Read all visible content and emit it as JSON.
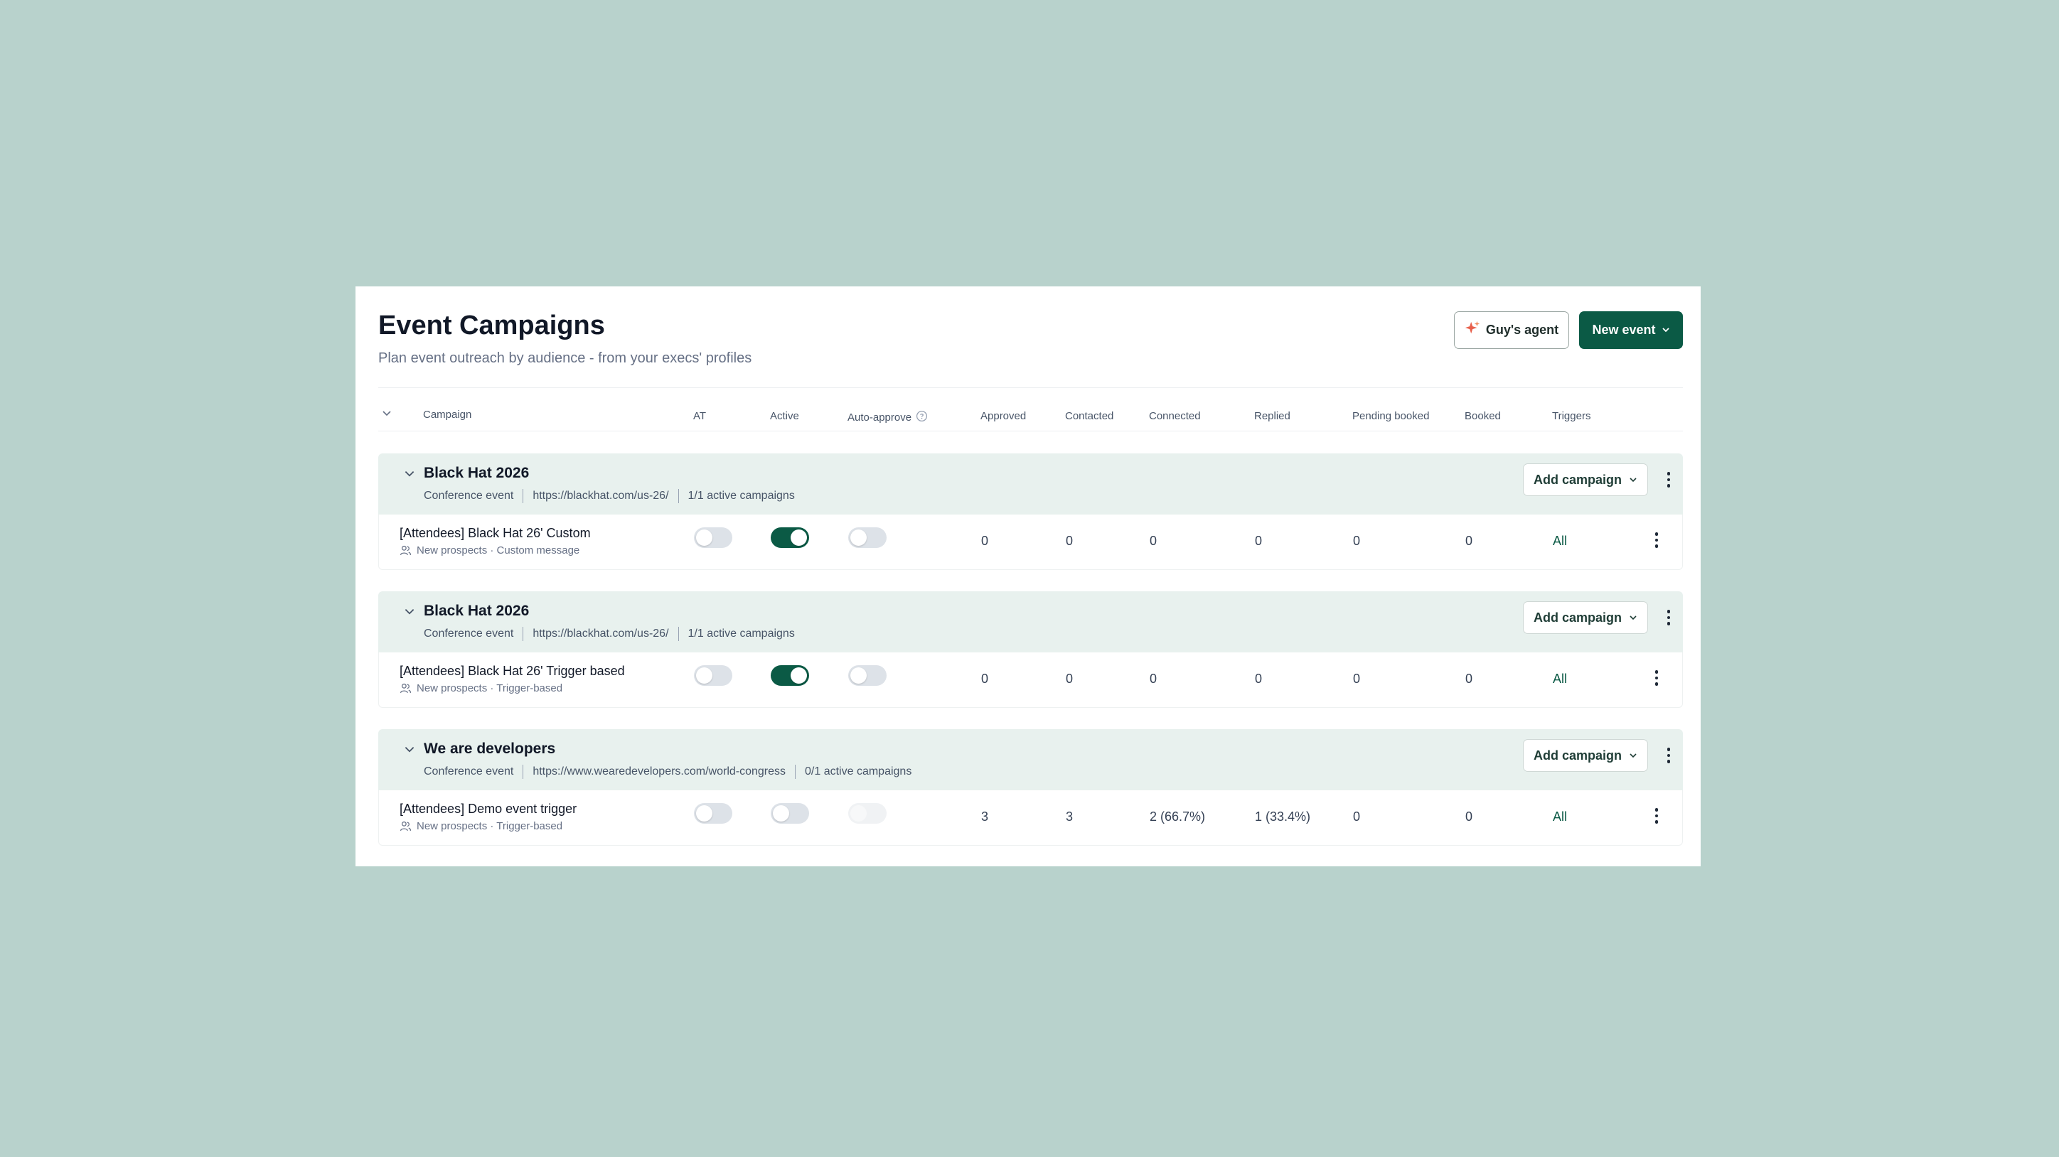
{
  "header": {
    "title": "Event Campaigns",
    "subtitle": "Plan event outreach by audience - from your execs' profiles",
    "agent_button": "Guy's agent",
    "new_event_button": "New event"
  },
  "columns": {
    "campaign": "Campaign",
    "at": "AT",
    "active": "Active",
    "auto_approve": "Auto-approve",
    "approved": "Approved",
    "contacted": "Contacted",
    "connected": "Connected",
    "replied": "Replied",
    "pending_booked": "Pending booked",
    "booked": "Booked",
    "triggers": "Triggers"
  },
  "groups": [
    {
      "title": "Black Hat 2026",
      "type": "Conference event",
      "url": "https://blackhat.com/us-26/",
      "active_campaigns": "1/1 active campaigns",
      "add_label": "Add campaign",
      "campaign": {
        "name": "[Attendees] Black Hat 26' Custom",
        "sub": "New prospects · Custom message",
        "at": false,
        "active": true,
        "auto_approve": false,
        "approved": "0",
        "contacted": "0",
        "connected": "0",
        "replied": "0",
        "pending_booked": "0",
        "booked": "0",
        "triggers": "All"
      }
    },
    {
      "title": "Black Hat 2026",
      "type": "Conference event",
      "url": "https://blackhat.com/us-26/",
      "active_campaigns": "1/1 active campaigns",
      "add_label": "Add campaign",
      "campaign": {
        "name": "[Attendees] Black Hat 26' Trigger based",
        "sub": "New prospects · Trigger-based",
        "at": false,
        "active": true,
        "auto_approve": false,
        "approved": "0",
        "contacted": "0",
        "connected": "0",
        "replied": "0",
        "pending_booked": "0",
        "booked": "0",
        "triggers": "All"
      }
    },
    {
      "title": "We are developers",
      "type": "Conference event",
      "url": "https://www.wearedevelopers.com/world-congress",
      "active_campaigns": "0/1 active campaigns",
      "add_label": "Add campaign",
      "campaign": {
        "name": "[Attendees] Demo event trigger",
        "sub": "New prospects · Trigger-based",
        "at": false,
        "active": false,
        "auto_approve": "disabled",
        "approved": "3",
        "contacted": "3",
        "connected": "2 (66.7%)",
        "replied": "1 (33.4%)",
        "pending_booked": "0",
        "booked": "0",
        "triggers": "All"
      }
    }
  ],
  "icons": [
    "sparkle-icon",
    "chevron-down-icon",
    "help-circle-icon",
    "users-icon",
    "kebab-menu-icon"
  ],
  "colors": {
    "background": "#b8d2cc",
    "primary": "#0b5a45",
    "group_bg": "#e8f1ee"
  }
}
